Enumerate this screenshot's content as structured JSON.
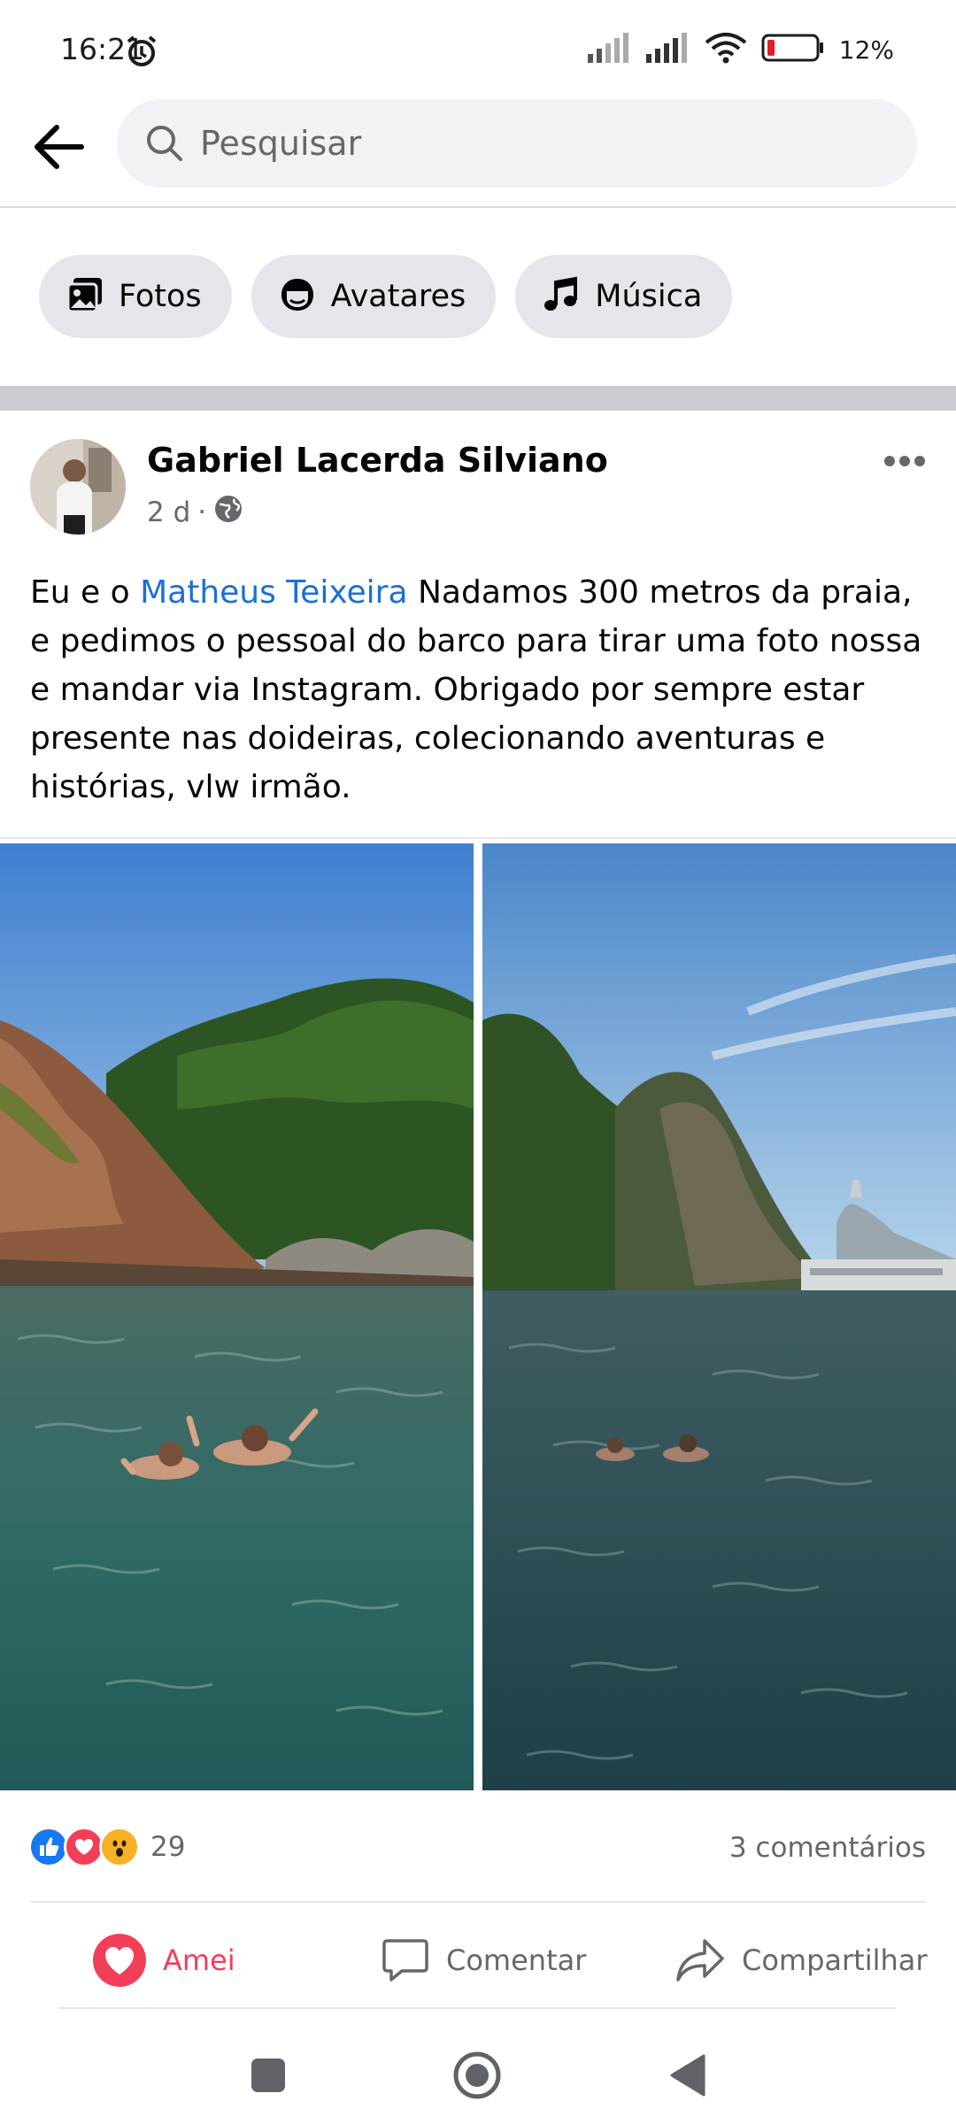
{
  "status_bar": {
    "time": "16:21",
    "battery": "12%"
  },
  "search": {
    "placeholder": "Pesquisar"
  },
  "chips": [
    {
      "label": "Fotos",
      "icon": "photos-icon"
    },
    {
      "label": "Avatares",
      "icon": "avatar-icon"
    },
    {
      "label": "Música",
      "icon": "music-icon"
    }
  ],
  "post": {
    "author": "Gabriel Lacerda Silviano",
    "time": "2 d",
    "separator": "·",
    "privacy_icon": "globe-icon",
    "text_before": "Eu e o ",
    "mention": "Matheus Teixeira",
    "text_after": " Nadamos 300 metros da praia, e pedimos o pessoal do barco para tirar uma foto nossa e mandar via Instagram. Obrigado por sempre estar presente nas doideiras, colecionando aventuras e histórias, vlw irmão.",
    "reaction_count": "29",
    "comments": "3 comentários"
  },
  "actions": {
    "love": "Amei",
    "comment": "Comentar",
    "share": "Compartilhar"
  },
  "colors": {
    "love": "#f33e58",
    "like": "#1877f2",
    "mention": "#1b6fd6"
  }
}
